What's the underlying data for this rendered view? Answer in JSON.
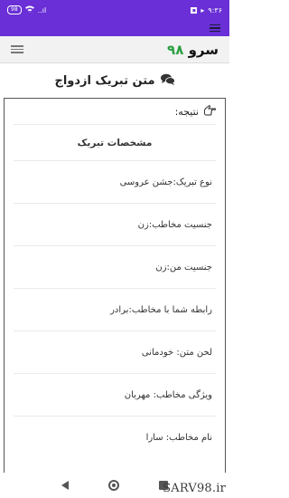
{
  "status_bar": {
    "time": "۹:۳۶",
    "battery": "98",
    "signal_label": "..ıl"
  },
  "header": {
    "logo_text": "سرو",
    "logo_number": "۹۸"
  },
  "page": {
    "title": "متن تبریک ازدواج"
  },
  "result": {
    "heading": "نتیجه:",
    "specs_title": "مشخصات تبریک",
    "items": [
      "نوع تبریک:جشن عروسی",
      "جنسیت مخاطب:زن",
      "جنسیت من:زن",
      "رابطه شما با مخاطب:برادر",
      "لحن متن: خودمانی",
      "ویژگی مخاطب: مهربان",
      "نام مخاطب: سارا"
    ]
  },
  "watermark": "SARV98.ir",
  "colors": {
    "status_bar": "#6a2fd6",
    "logo_number": "#2ea043"
  }
}
